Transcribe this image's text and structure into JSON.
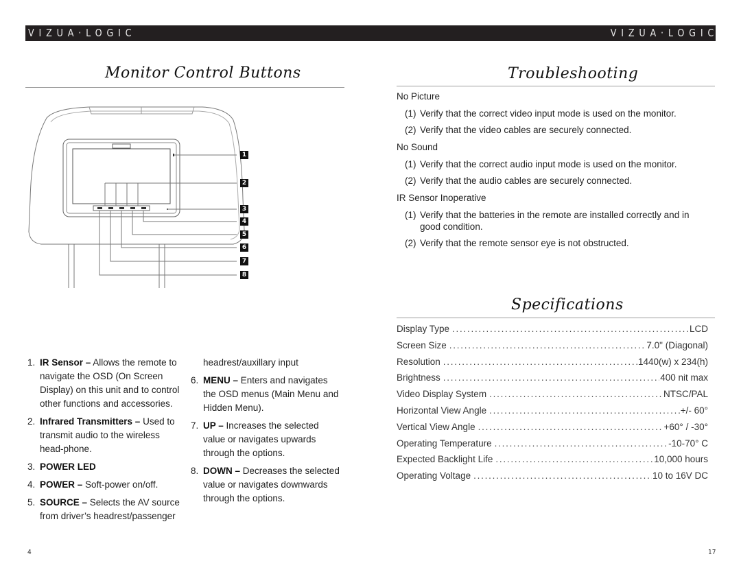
{
  "header": {
    "brand_left": "VIZUA·LOGIC",
    "brand_right": "VIZUA·LOGIC"
  },
  "left_page": {
    "title": "Monitor Control Buttons",
    "callouts": [
      "1",
      "2",
      "3",
      "4",
      "5",
      "6",
      "7",
      "8"
    ],
    "items": [
      {
        "num": "1.",
        "term": "IR Sensor –",
        "desc": " Allows the remote to navigate the OSD (On Screen Display) on this unit and to control other functions and accessories."
      },
      {
        "num": "2.",
        "term": "Infrared Transmitters –",
        "desc": " Used to transmit audio to the wireless head-phone."
      },
      {
        "num": "3.",
        "term": "POWER LED",
        "desc": ""
      },
      {
        "num": "4.",
        "term": "POWER –",
        "desc": " Soft-power on/off."
      },
      {
        "num": "5.",
        "term": "SOURCE –",
        "desc": " Selects the AV source from driver’s headrest/passenger"
      },
      {
        "continuation": "headrest/auxillary input"
      },
      {
        "num": "6.",
        "term": "MENU –",
        "desc": " Enters and navigates the OSD menus (Main Menu and Hidden Menu)."
      },
      {
        "num": "7.",
        "term": "UP –",
        "desc": " Increases the selected value or navigates upwards through the options."
      },
      {
        "num": "8.",
        "term": "DOWN –",
        "desc": " Decreases the selected value or navigates downwards through the options."
      }
    ],
    "page_number": "4"
  },
  "right_page": {
    "troubleshooting": {
      "title": "Troubleshooting",
      "sections": [
        {
          "heading": "No Picture",
          "steps": [
            {
              "n": "(1)",
              "text": "Verify that the correct video input mode is used on the monitor."
            },
            {
              "n": "(2)",
              "text": "Verify that the video cables are securely connected."
            }
          ]
        },
        {
          "heading": "No Sound",
          "steps": [
            {
              "n": "(1)",
              "text": "Verify that the correct audio input mode is used on the monitor."
            },
            {
              "n": "(2)",
              "text": "Verify that the audio cables are securely connected."
            }
          ]
        },
        {
          "heading": "IR Sensor Inoperative",
          "steps": [
            {
              "n": "(1)",
              "text": "Verify that the batteries in the remote are installed correctly and in good condition."
            },
            {
              "n": "(2)",
              "text": "Verify that the remote sensor eye is not obstructed."
            }
          ]
        }
      ]
    },
    "specifications": {
      "title": "Specifications",
      "rows": [
        {
          "label": "Display Type",
          "value": "LCD"
        },
        {
          "label": "Screen Size",
          "value": "7.0\" (Diagonal)"
        },
        {
          "label": "Resolution",
          "value": "1440(w) x 234(h)"
        },
        {
          "label": "Brightness",
          "value": "400 nit max"
        },
        {
          "label": "Video Display System",
          "value": "NTSC/PAL"
        },
        {
          "label": "Horizontal View Angle",
          "value": "+/- 60°"
        },
        {
          "label": "Vertical View Angle",
          "value": "+60° / -30°"
        },
        {
          "label": "Operating Temperature",
          "value": "-10-70° C"
        },
        {
          "label": "Expected Backlight Life",
          "value": "10,000 hours"
        },
        {
          "label": "Operating Voltage",
          "value": "10 to 16V DC"
        }
      ]
    },
    "page_number": "17"
  }
}
